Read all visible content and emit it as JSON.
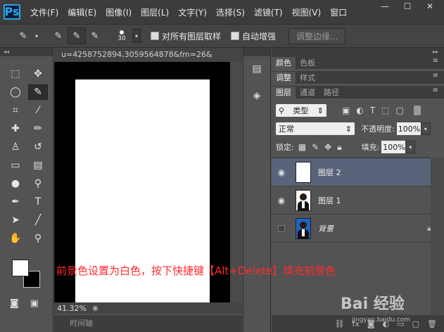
{
  "app": {
    "logo": "Ps"
  },
  "menu": [
    "文件(F)",
    "编辑(E)",
    "图像(I)",
    "图层(L)",
    "文字(Y)",
    "选择(S)",
    "滤镜(T)",
    "视图(V)",
    "窗口"
  ],
  "window_buttons": [
    "—",
    "☐",
    "✕"
  ],
  "options": {
    "brush_size": "30",
    "sample_all_label": "对所有图层取样",
    "auto_enhance_label": "自动增强",
    "refine_edge_label": "调整边缘..."
  },
  "document": {
    "tab_title": "u=4258752894,3059564878&fm=26&",
    "zoom": "41.32%",
    "timeline_label": "时间轴"
  },
  "panels": {
    "row1": [
      {
        "label": "颜色",
        "active": true
      },
      {
        "label": "色板",
        "active": false
      }
    ],
    "row2": [
      {
        "label": "调整",
        "active": true
      },
      {
        "label": "样式",
        "active": false
      }
    ],
    "row3": [
      {
        "label": "图层",
        "active": true
      },
      {
        "label": "通道",
        "active": false
      },
      {
        "label": "路径",
        "active": false
      }
    ]
  },
  "layers_panel": {
    "filter_kind": "类型",
    "blend_mode": "正常",
    "opacity_label": "不透明度:",
    "opacity_value": "100%",
    "lock_label": "锁定:",
    "fill_label": "填充:",
    "fill_value": "100%",
    "layers": [
      {
        "name": "图层 2",
        "selected": true,
        "visible": true,
        "thumb": "white"
      },
      {
        "name": "图层 1",
        "selected": false,
        "visible": true,
        "thumb": "photo-white"
      },
      {
        "name": "背景",
        "selected": false,
        "visible": false,
        "thumb": "photo-blue",
        "locked": true
      }
    ]
  },
  "annotation": "前景色设置为白色，按下快捷键【Alt+Delete】填充前景色",
  "watermark": {
    "text": "Bai 经验",
    "sub": "jingyan.baidu.com"
  },
  "colors": {
    "foreground": "#ffffff",
    "background": "#000000",
    "annotation": "#ff2a2a",
    "selected_layer": "#59647a"
  }
}
